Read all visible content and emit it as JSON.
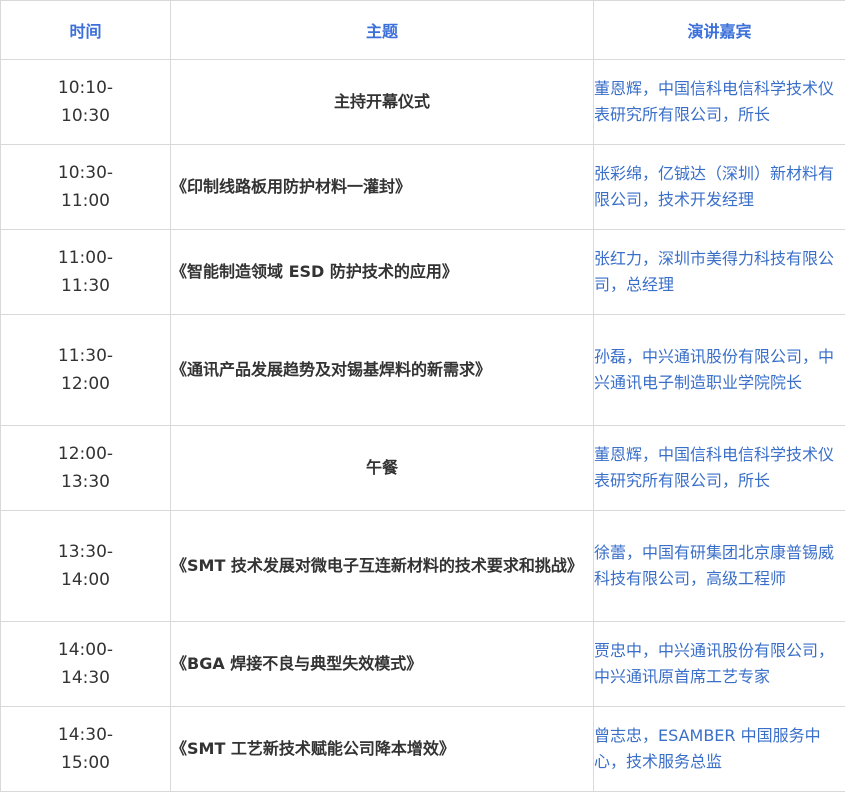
{
  "table": {
    "headers": {
      "time": "时间",
      "topic": "主题",
      "speaker": "演讲嘉宾"
    },
    "rows": [
      {
        "time_start": "10:10-",
        "time_end": "10:30",
        "topic": "主持开幕仪式",
        "speaker": "董恩辉，中国信科电信科学技术仪表研究所有限公司，所长"
      },
      {
        "time_start": "10:30-",
        "time_end": "11:00",
        "topic": "《印制线路板用防护材料一灌封》",
        "speaker": "张彩绵，亿铖达（深圳）新材料有限公司，技术开发经理"
      },
      {
        "time_start": "11:00-",
        "time_end": "11:30",
        "topic": "《智能制造领域 ESD 防护技术的应用》",
        "speaker": "张红力，深圳市美得力科技有限公司，总经理"
      },
      {
        "time_start": "11:30-",
        "time_end": "12:00",
        "topic": "《通讯产品发展趋势及对锡基焊料的新需求》",
        "speaker": "孙磊，中兴通讯股份有限公司，中兴通讯电子制造职业学院院长"
      },
      {
        "time_start": "12:00-",
        "time_end": "13:30",
        "topic": "午餐",
        "speaker": "董恩辉，中国信科电信科学技术仪表研究所有限公司，所长"
      },
      {
        "time_start": "13:30-",
        "time_end": "14:00",
        "topic": "《SMT 技术发展对微电子互连新材料的技术要求和挑战》",
        "speaker": "徐蕾，中国有研集团北京康普锡威科技有限公司，高级工程师"
      },
      {
        "time_start": "14:00-",
        "time_end": "14:30",
        "topic": "《BGA 焊接不良与典型失效模式》",
        "speaker": "贾忠中，中兴通讯股份有限公司，中兴通讯原首席工艺专家"
      },
      {
        "time_start": "14:30-",
        "time_end": "15:00",
        "topic": "《SMT 工艺新技术赋能公司降本增效》",
        "speaker": "曾志忠，ESAMBER 中国服务中心，技术服务总监"
      }
    ]
  }
}
